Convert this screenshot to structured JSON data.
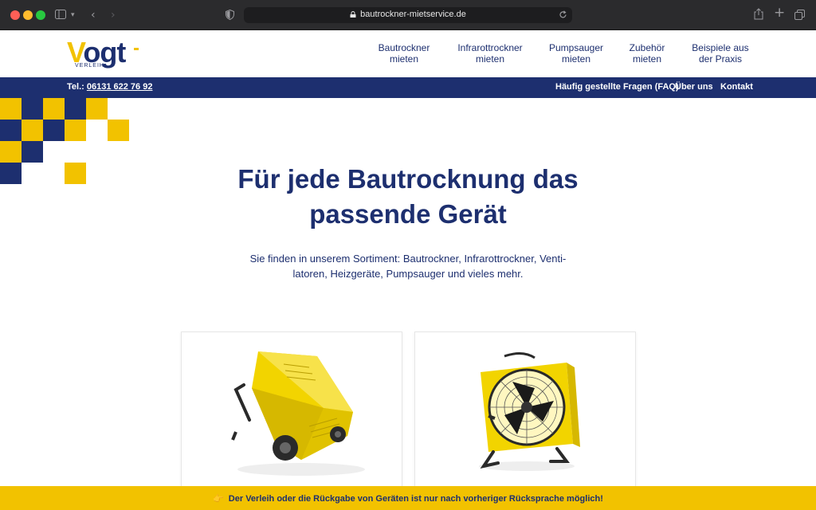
{
  "browser": {
    "url": "bautrockner-mietservice.de"
  },
  "logo": {
    "letter_v": "V",
    "rest": "ogt",
    "sub": "VERLEIH"
  },
  "nav": [
    {
      "line1": "Bautrockner",
      "line2": "mieten"
    },
    {
      "line1": "Infrarottrockner",
      "line2": "mieten"
    },
    {
      "line1": "Pumpsauger",
      "line2": "mieten"
    },
    {
      "line1": "Zubehör",
      "line2": "mieten"
    },
    {
      "line1": "Beispiele aus",
      "line2": "der Praxis"
    }
  ],
  "topbar": {
    "tel_label": "Tel.:",
    "tel_number": "06131 622 76 92",
    "links": [
      "Häufig gestellte Fragen (FAQ)",
      "Über uns",
      "Kontakt"
    ]
  },
  "hero": {
    "title_line1": "Für jede Bautrocknung das",
    "title_line2": "passende Gerät",
    "sub_line1": "Sie finden in unserem Sortiment: Bautrockner, Infrarottrockner, Venti-",
    "sub_line2": "latoren, Heizgeräte, Pumpsauger und vieles mehr."
  },
  "notice": {
    "icon": "pointing-hand-icon",
    "text": "Der Verleih oder die Rückgabe von Geräten ist nur nach vorheriger Rücksprache möglich!"
  },
  "colors": {
    "brand_blue": "#1d2f6f",
    "brand_yellow": "#f2c200"
  }
}
